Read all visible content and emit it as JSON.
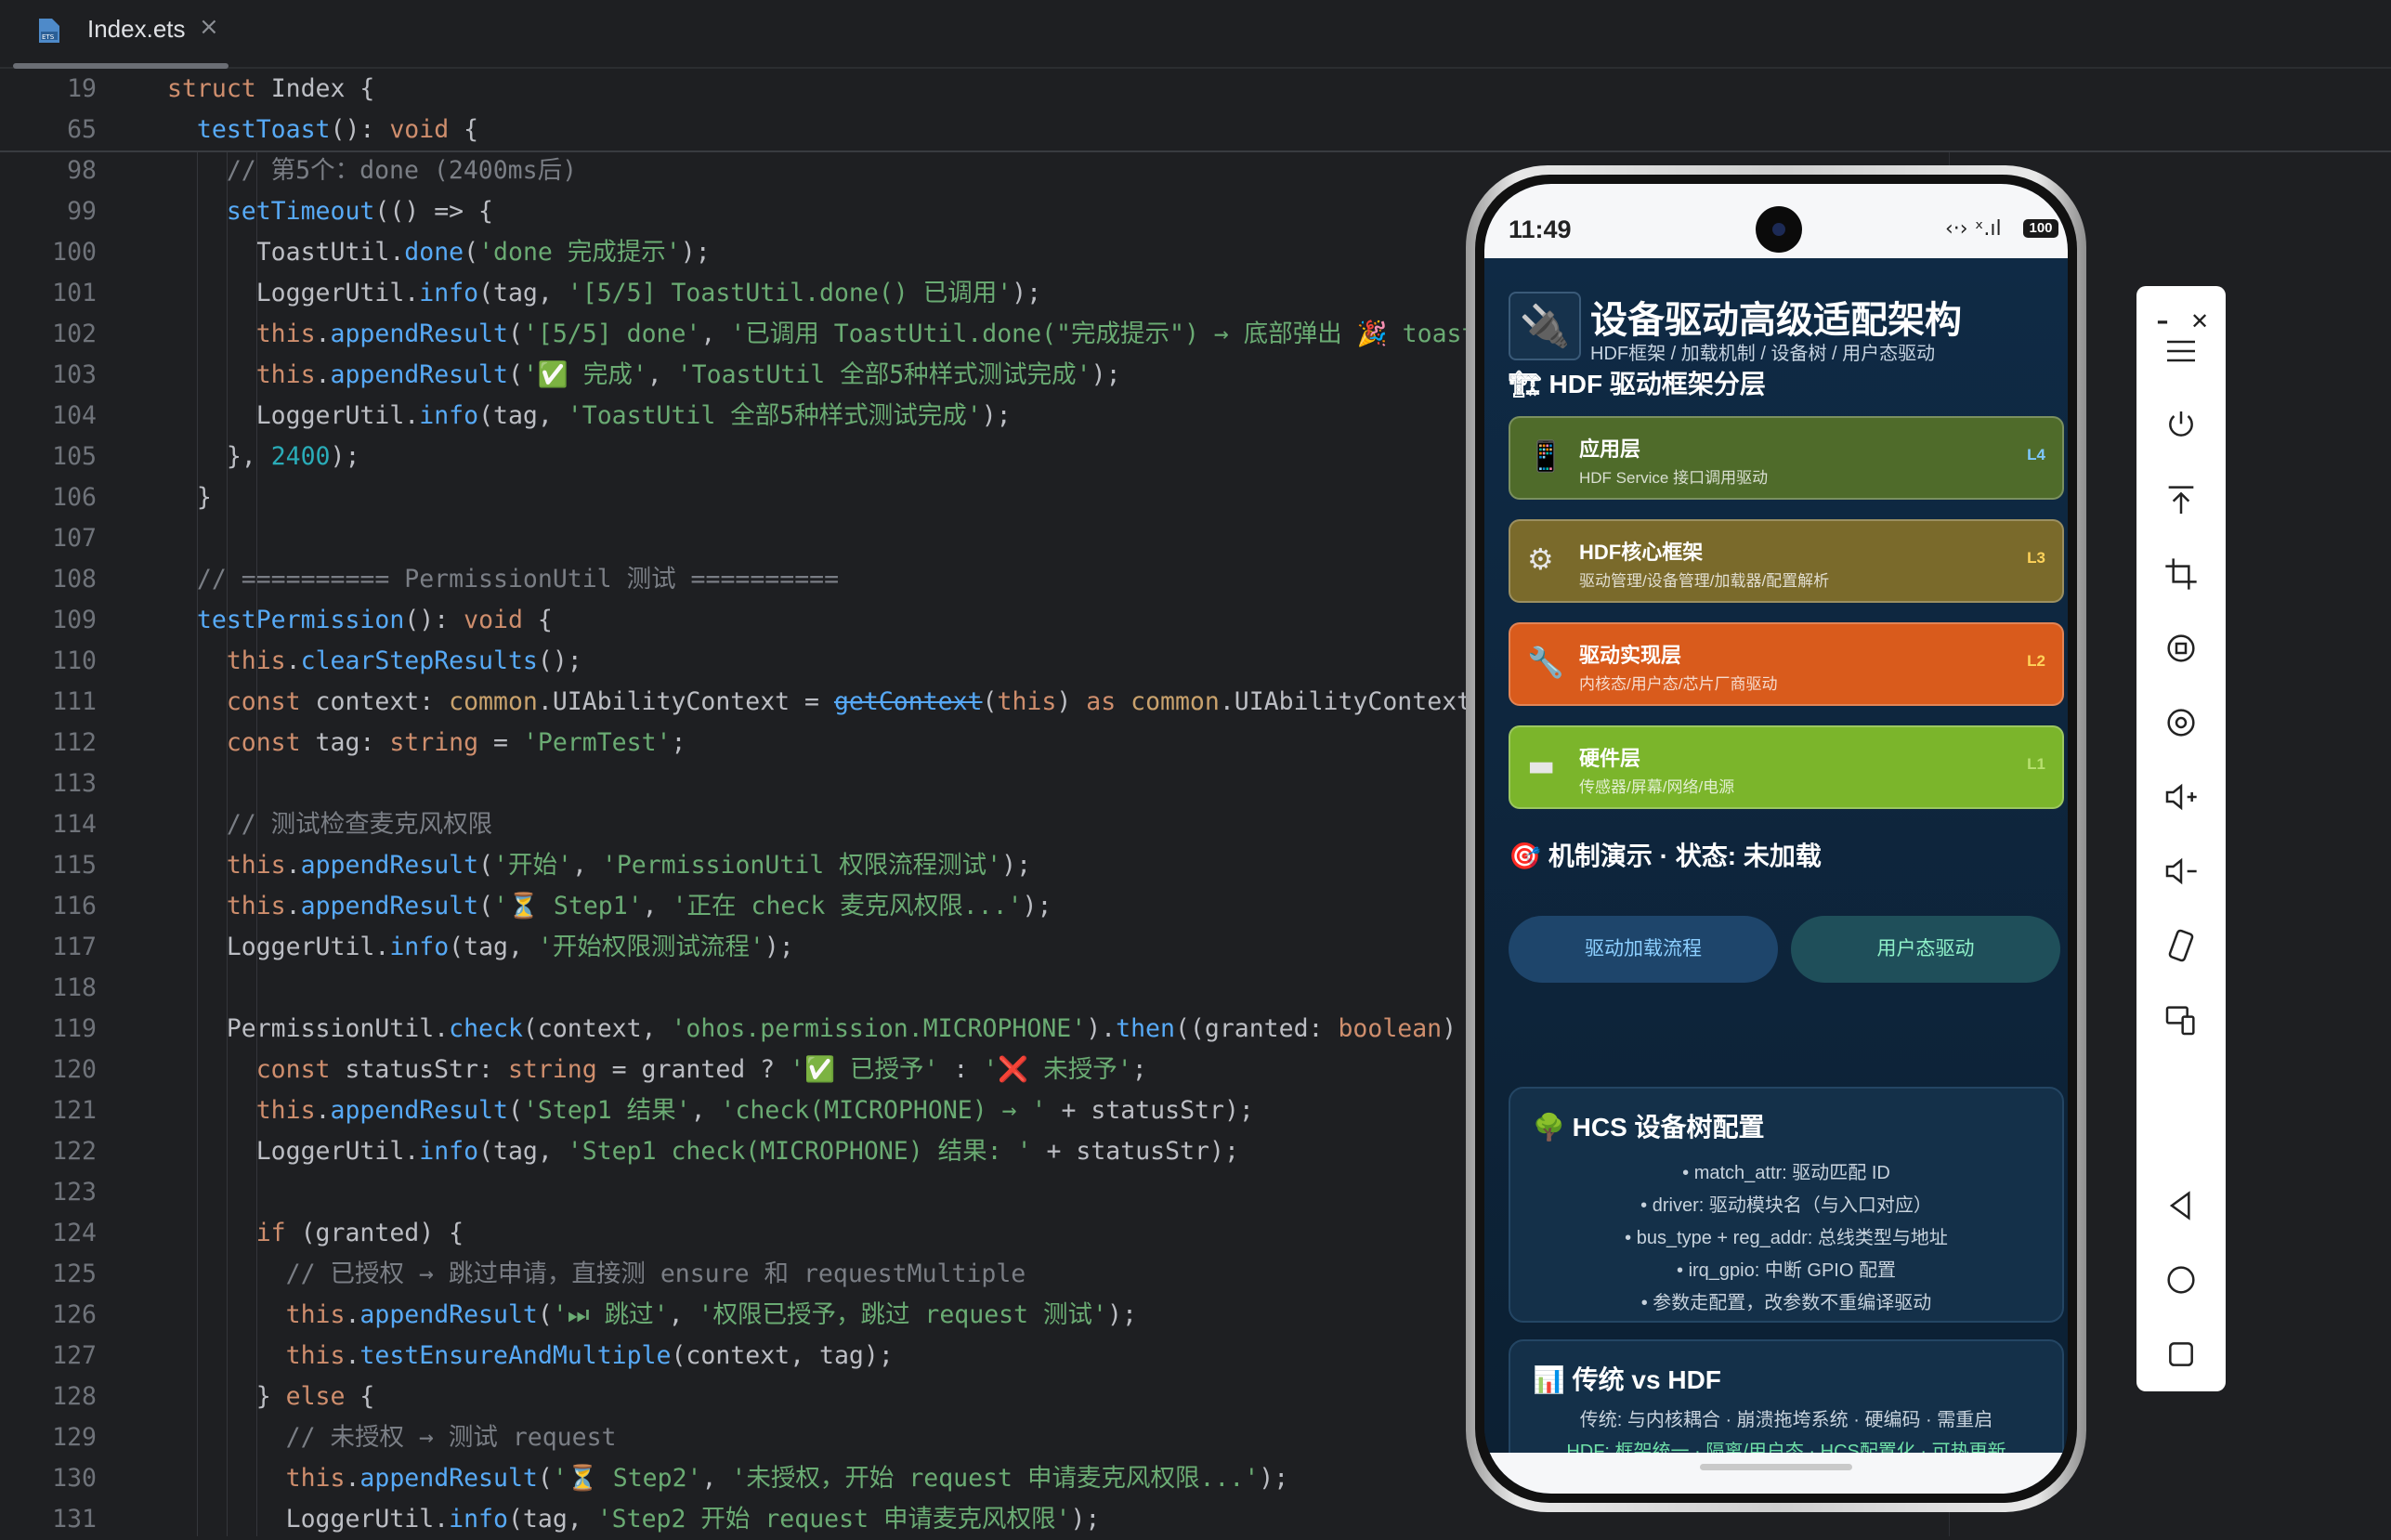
{
  "tab": {
    "filename": "Index.ets",
    "close": "×"
  },
  "sticky": [
    {
      "ln": "19",
      "parts": [
        [
          "kw",
          "struct "
        ],
        [
          "cls",
          "Index "
        ],
        [
          "pl",
          "{"
        ]
      ]
    },
    {
      "ln": "65",
      "parts": [
        [
          "fn",
          "  testToast"
        ],
        [
          "pl",
          "(): "
        ],
        [
          "kw",
          "void "
        ],
        [
          "pl",
          "{"
        ]
      ]
    }
  ],
  "lines": [
    {
      "ln": "98",
      "parts": [
        [
          "cm",
          "    // 第5个：done (2400ms后)"
        ]
      ]
    },
    {
      "ln": "99",
      "parts": [
        [
          "fn",
          "    setTimeout"
        ],
        [
          "pl",
          "(() => {"
        ]
      ]
    },
    {
      "ln": "100",
      "parts": [
        [
          "pl",
          "      ToastUtil."
        ],
        [
          "fn",
          "done"
        ],
        [
          "pl",
          "("
        ],
        [
          "str",
          "'done 完成提示'"
        ],
        [
          "pl",
          ");"
        ]
      ]
    },
    {
      "ln": "101",
      "parts": [
        [
          "pl",
          "      LoggerUtil."
        ],
        [
          "fn",
          "info"
        ],
        [
          "pl",
          "(tag, "
        ],
        [
          "str",
          "'[5/5] ToastUtil.done() 已调用'"
        ],
        [
          "pl",
          ");"
        ]
      ]
    },
    {
      "ln": "102",
      "parts": [
        [
          "kw",
          "      this"
        ],
        [
          "pl",
          "."
        ],
        [
          "fn",
          "appendResult"
        ],
        [
          "pl",
          "("
        ],
        [
          "str",
          "'[5/5] done'"
        ],
        [
          "pl",
          ", "
        ],
        [
          "str",
          "'已调用 ToastUtil.done(\"完成提示\") → 底部弹出 🎉 toast'"
        ]
      ]
    },
    {
      "ln": "103",
      "parts": [
        [
          "kw",
          "      this"
        ],
        [
          "pl",
          "."
        ],
        [
          "fn",
          "appendResult"
        ],
        [
          "pl",
          "("
        ],
        [
          "str",
          "'✅ 完成'"
        ],
        [
          "pl",
          ", "
        ],
        [
          "str",
          "'ToastUtil 全部5种样式测试完成'"
        ],
        [
          "pl",
          ");"
        ]
      ]
    },
    {
      "ln": "104",
      "parts": [
        [
          "pl",
          "      LoggerUtil."
        ],
        [
          "fn",
          "info"
        ],
        [
          "pl",
          "(tag, "
        ],
        [
          "str",
          "'ToastUtil 全部5种样式测试完成'"
        ],
        [
          "pl",
          ");"
        ]
      ]
    },
    {
      "ln": "105",
      "parts": [
        [
          "pl",
          "    }, "
        ],
        [
          "num",
          "2400"
        ],
        [
          "pl",
          ");"
        ]
      ]
    },
    {
      "ln": "106",
      "parts": [
        [
          "pl",
          "  }"
        ]
      ]
    },
    {
      "ln": "107",
      "parts": []
    },
    {
      "ln": "108",
      "parts": [
        [
          "cm",
          "  // ========== PermissionUtil 测试 =========="
        ]
      ]
    },
    {
      "ln": "109",
      "parts": [
        [
          "fn",
          "  testPermission"
        ],
        [
          "pl",
          "(): "
        ],
        [
          "kw",
          "void "
        ],
        [
          "pl",
          "{"
        ]
      ]
    },
    {
      "ln": "110",
      "parts": [
        [
          "kw",
          "    this"
        ],
        [
          "pl",
          "."
        ],
        [
          "fn",
          "clearStepResults"
        ],
        [
          "pl",
          "();"
        ]
      ]
    },
    {
      "ln": "111",
      "parts": [
        [
          "kw",
          "    const "
        ],
        [
          "pl",
          "context: "
        ],
        [
          "cmn",
          "common"
        ],
        [
          "pl",
          ".UIAbilityContext = "
        ],
        [
          "strike",
          "getContext"
        ],
        [
          "pl",
          "("
        ],
        [
          "kw",
          "this"
        ],
        [
          "pl",
          ") "
        ],
        [
          "kw",
          "as "
        ],
        [
          "cmn",
          "common"
        ],
        [
          "pl",
          ".UIAbilityContext"
        ]
      ]
    },
    {
      "ln": "112",
      "parts": [
        [
          "kw",
          "    const "
        ],
        [
          "pl",
          "tag: "
        ],
        [
          "kw",
          "string "
        ],
        [
          "pl",
          "= "
        ],
        [
          "str",
          "'PermTest'"
        ],
        [
          "pl",
          ";"
        ]
      ]
    },
    {
      "ln": "113",
      "parts": []
    },
    {
      "ln": "114",
      "parts": [
        [
          "cm",
          "    // 测试检查麦克风权限"
        ]
      ]
    },
    {
      "ln": "115",
      "parts": [
        [
          "kw",
          "    this"
        ],
        [
          "pl",
          "."
        ],
        [
          "fn",
          "appendResult"
        ],
        [
          "pl",
          "("
        ],
        [
          "str",
          "'开始'"
        ],
        [
          "pl",
          ", "
        ],
        [
          "str",
          "'PermissionUtil 权限流程测试'"
        ],
        [
          "pl",
          ");"
        ]
      ]
    },
    {
      "ln": "116",
      "parts": [
        [
          "kw",
          "    this"
        ],
        [
          "pl",
          "."
        ],
        [
          "fn",
          "appendResult"
        ],
        [
          "pl",
          "("
        ],
        [
          "str",
          "'⏳ Step1'"
        ],
        [
          "pl",
          ", "
        ],
        [
          "str",
          "'正在 check 麦克风权限...'"
        ],
        [
          "pl",
          ");"
        ]
      ]
    },
    {
      "ln": "117",
      "parts": [
        [
          "pl",
          "    LoggerUtil."
        ],
        [
          "fn",
          "info"
        ],
        [
          "pl",
          "(tag, "
        ],
        [
          "str",
          "'开始权限测试流程'"
        ],
        [
          "pl",
          ");"
        ]
      ]
    },
    {
      "ln": "118",
      "parts": []
    },
    {
      "ln": "119",
      "parts": [
        [
          "pl",
          "    PermissionUtil."
        ],
        [
          "fn",
          "check"
        ],
        [
          "pl",
          "(context, "
        ],
        [
          "str",
          "'ohos.permission.MICROPHONE'"
        ],
        [
          "pl",
          ")."
        ],
        [
          "fn",
          "then"
        ],
        [
          "pl",
          "((granted: "
        ],
        [
          "kw",
          "boolean"
        ],
        [
          "pl",
          ")"
        ]
      ]
    },
    {
      "ln": "120",
      "parts": [
        [
          "kw",
          "      const "
        ],
        [
          "pl",
          "statusStr: "
        ],
        [
          "kw",
          "string "
        ],
        [
          "pl",
          "= granted ? "
        ],
        [
          "str",
          "'✅ 已授予'"
        ],
        [
          "pl",
          " : "
        ],
        [
          "str",
          "'❌ 未授予'"
        ],
        [
          "pl",
          ";"
        ]
      ]
    },
    {
      "ln": "121",
      "parts": [
        [
          "kw",
          "      this"
        ],
        [
          "pl",
          "."
        ],
        [
          "fn",
          "appendResult"
        ],
        [
          "pl",
          "("
        ],
        [
          "str",
          "'Step1 结果'"
        ],
        [
          "pl",
          ", "
        ],
        [
          "str",
          "'check(MICROPHONE) → '"
        ],
        [
          "pl",
          " + statusStr);"
        ]
      ]
    },
    {
      "ln": "122",
      "parts": [
        [
          "pl",
          "      LoggerUtil."
        ],
        [
          "fn",
          "info"
        ],
        [
          "pl",
          "(tag, "
        ],
        [
          "str",
          "'Step1 check(MICROPHONE) 结果: '"
        ],
        [
          "pl",
          " + statusStr);"
        ]
      ]
    },
    {
      "ln": "123",
      "parts": []
    },
    {
      "ln": "124",
      "parts": [
        [
          "kw",
          "      if "
        ],
        [
          "pl",
          "(granted) {"
        ]
      ]
    },
    {
      "ln": "125",
      "parts": [
        [
          "cm",
          "        // 已授权 → 跳过申请，直接测 ensure 和 requestMultiple"
        ]
      ]
    },
    {
      "ln": "126",
      "parts": [
        [
          "kw",
          "        this"
        ],
        [
          "pl",
          "."
        ],
        [
          "fn",
          "appendResult"
        ],
        [
          "pl",
          "("
        ],
        [
          "str",
          "'⏭ 跳过'"
        ],
        [
          "pl",
          ", "
        ],
        [
          "str",
          "'权限已授予，跳过 request 测试'"
        ],
        [
          "pl",
          ");"
        ]
      ]
    },
    {
      "ln": "127",
      "parts": [
        [
          "kw",
          "        this"
        ],
        [
          "pl",
          "."
        ],
        [
          "fn",
          "testEnsureAndMultiple"
        ],
        [
          "pl",
          "(context, tag);"
        ]
      ]
    },
    {
      "ln": "128",
      "parts": [
        [
          "pl",
          "      } "
        ],
        [
          "kw",
          "else "
        ],
        [
          "pl",
          "{"
        ]
      ]
    },
    {
      "ln": "129",
      "parts": [
        [
          "cm",
          "        // 未授权 → 测试 request"
        ]
      ]
    },
    {
      "ln": "130",
      "parts": [
        [
          "kw",
          "        this"
        ],
        [
          "pl",
          "."
        ],
        [
          "fn",
          "appendResult"
        ],
        [
          "pl",
          "("
        ],
        [
          "str",
          "'⏳ Step2'"
        ],
        [
          "pl",
          ", "
        ],
        [
          "str",
          "'未授权，开始 request 申请麦克风权限...'"
        ],
        [
          "pl",
          ");"
        ]
      ]
    },
    {
      "ln": "131",
      "parts": [
        [
          "pl",
          "        LoggerUtil."
        ],
        [
          "fn",
          "info"
        ],
        [
          "pl",
          "(tag, "
        ],
        [
          "str",
          "'Step2 开始 request 申请麦克风权限'"
        ],
        [
          "pl",
          ");"
        ]
      ]
    }
  ],
  "phone": {
    "time": "11:49",
    "status_icons": "‹·› ˣ.ıl",
    "battery": "100",
    "app": {
      "title": "设备驱动高级适配架构",
      "subtitle": "HDF框架 / 加载机制 / 设备树 / 用户态驱动",
      "layers_title": "HDF 驱动框架分层",
      "layers": [
        {
          "icon": "📱",
          "name": "应用层",
          "desc": "HDF Service 接口调用驱动",
          "tag": "L4",
          "bg": "#4f6b2a",
          "tag_color": "#7ec8ff"
        },
        {
          "icon": "⚙",
          "name": "HDF核心框架",
          "desc": "驱动管理/设备管理/加载器/配置解析",
          "tag": "L3",
          "bg": "#7a6a2b",
          "tag_color": "#ffd35a"
        },
        {
          "icon": "🔧",
          "name": "驱动实现层",
          "desc": "内核态/用户态/芯片厂商驱动",
          "tag": "L2",
          "bg": "#d95b1c",
          "tag_color": "#ffd35a"
        },
        {
          "icon": "▬",
          "name": "硬件层",
          "desc": "传感器/屏幕/网络/电源",
          "tag": "L1",
          "bg": "#7bb52b",
          "tag_color": "#b8e070"
        }
      ],
      "demo_title": "机制演示 · 状态: 未加载",
      "buttons": [
        {
          "label": "驱动加载流程",
          "bg": "#1e456b",
          "color": "#8ccfff"
        },
        {
          "label": "用户态驱动",
          "bg": "#1f4f5a",
          "color": "#8ef0c8"
        }
      ],
      "hcs": {
        "title": "HCS 设备树配置",
        "items": [
          "• match_attr: 驱动匹配 ID",
          "• driver: 驱动模块名（与入口对应）",
          "• bus_type + reg_addr: 总线类型与地址",
          "• irq_gpio: 中断 GPIO 配置",
          "• 参数走配置，改参数不重编译驱动"
        ]
      },
      "compare": {
        "title": "传统 vs HDF",
        "traditional": "传统: 与内核耦合 · 崩溃拖垮系统 · 硬编码 · 需重启",
        "hdf": "HDF: 框架统一 · 隔离/用户态 · HCS配置化 · 可热更新"
      }
    }
  },
  "toolbar": {
    "minimize": "–",
    "close": "✕",
    "tools": [
      "menu-icon",
      "power-icon",
      "upload-icon",
      "crop-icon",
      "rotate-icon",
      "screenshot-icon",
      "volume-up-icon",
      "volume-down-icon",
      "rotate-device-icon",
      "multi-device-icon",
      "back-icon",
      "home-icon",
      "recent-icon"
    ]
  }
}
